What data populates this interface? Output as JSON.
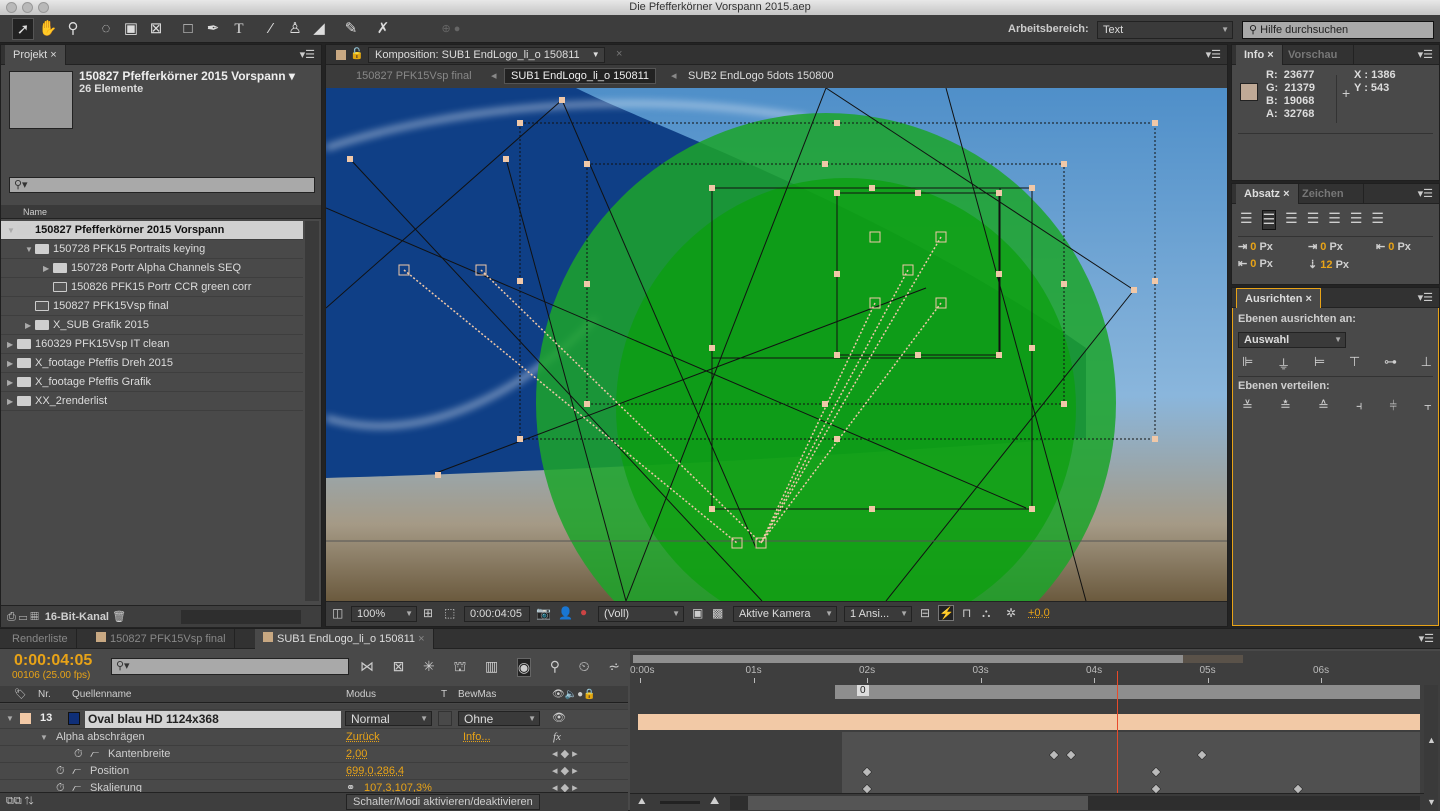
{
  "window": {
    "title": "Die Pfefferkörner Vorspann 2015.aep"
  },
  "toolbar": {
    "tools": [
      "selection-tool",
      "hand-tool",
      "zoom-tool",
      "rotate-tool",
      "camera-tool",
      "pan-behind-tool",
      "rectangle-tool",
      "pen-tool",
      "type-tool",
      "brush-tool",
      "clone-stamp-tool",
      "eraser-tool",
      "roto-brush-tool",
      "puppet-pin-tool"
    ],
    "workspace_label": "Arbeitsbereich:",
    "workspace_value": "Text",
    "help_placeholder": "Hilfe durchsuchen"
  },
  "project": {
    "tab": "Projekt",
    "name": "150827 Pfefferkörner 2015 Vorspann ▾",
    "count": "26 Elemente",
    "search_placeholder": "",
    "col_name": "Name",
    "items": [
      {
        "label": "150827 Pfefferkörner 2015 Vorspann",
        "type": "folder",
        "open": true
      },
      {
        "label": "150728 PFK15 Portraits keying",
        "type": "folder",
        "open": true
      },
      {
        "label": "150728 Portr Alpha Channels SEQ",
        "type": "folder",
        "open": false
      },
      {
        "label": "150826 PFK15 Portr CCR green corr",
        "type": "comp"
      },
      {
        "label": "150827 PFK15Vsp final",
        "type": "comp"
      },
      {
        "label": "X_SUB Grafik 2015",
        "type": "folder",
        "open": false
      },
      {
        "label": "160329 PFK15Vsp IT clean",
        "type": "folder",
        "open": false
      },
      {
        "label": "X_footage Pfeffis Dreh 2015",
        "type": "folder",
        "open": false
      },
      {
        "label": "X_footage Pfeffis Grafik",
        "type": "folder",
        "open": false
      },
      {
        "label": "XX_2renderlist",
        "type": "folder",
        "open": false
      }
    ],
    "bitdepth": "16-Bit-Kanal"
  },
  "composition": {
    "tab": "Komposition: SUB1 EndLogo_li_o 150811",
    "flow": [
      "150827 PFK15Vsp final",
      "SUB1 EndLogo_li_o 150811",
      "SUB2 EndLogo 5dots 150800"
    ],
    "footer": {
      "zoom": "100%",
      "timecode": "0:00:04:05",
      "resolution": "(Voll)",
      "camera": "Aktive Kamera",
      "views": "1 Ansi...",
      "exposure": "+0,0"
    }
  },
  "info": {
    "tab": "Info",
    "tab2": "Vorschau",
    "R": "23677",
    "G": "21379",
    "B": "19068",
    "A": "32768",
    "X": "1386",
    "Y": "543",
    "swatch": "#bfa996"
  },
  "absatz": {
    "tab": "Absatz",
    "tab2": "Zeichen",
    "indent_left": "0",
    "indent_first": "0",
    "indent_right": "0",
    "space_before": "0",
    "space_after": "12",
    "unit": "Px"
  },
  "ausrichten": {
    "tab": "Ausrichten",
    "align_to_label": "Ebenen ausrichten an:",
    "align_to_value": "Auswahl",
    "distribute_label": "Ebenen verteilen:"
  },
  "timeline": {
    "tabs": [
      "Renderliste",
      "150827 PFK15Vsp final",
      "SUB1 EndLogo_li_o 150811"
    ],
    "timecode": "0:00:04:05",
    "frames": "00106 (25.00 fps)",
    "columns": {
      "nr": "Nr.",
      "source": "Quellenname",
      "mode": "Modus",
      "t": "T",
      "trkmat": "BewMas"
    },
    "layer": {
      "nr": "13",
      "name": "Oval blau HD 1124x368",
      "mode": "Normal",
      "trkmat": "Ohne",
      "color": "#f2c9a6"
    },
    "effect": {
      "name": "Alpha abschrägen",
      "reset": "Zurück",
      "about": "Info..."
    },
    "props": [
      {
        "name": "Kantenbreite",
        "value": "2,00"
      },
      {
        "name": "Position",
        "value": "699,0,286,4"
      },
      {
        "name": "Skalierung",
        "value": "107,3,107,3%"
      }
    ],
    "ruler": [
      "0:00s",
      "01s",
      "02s",
      "03s",
      "04s",
      "05s",
      "06s"
    ],
    "work_area_label": "0",
    "toggle_label": "Schalter/Modi aktivieren/deaktivieren"
  },
  "colors": {
    "accent": "#e8a317",
    "playhead": "#e84a2a"
  }
}
